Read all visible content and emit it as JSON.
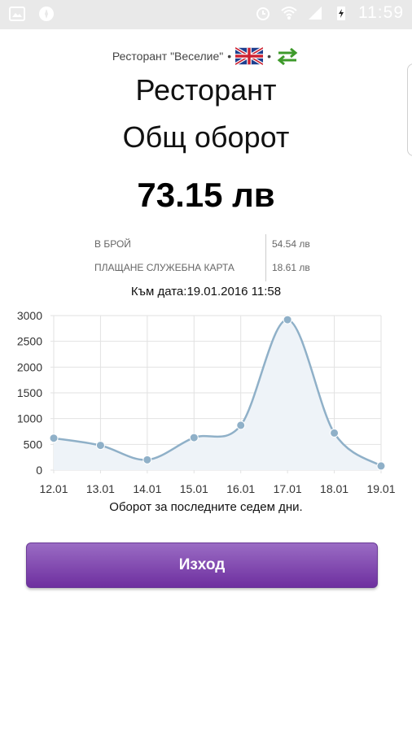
{
  "status_bar": {
    "time": "11:59",
    "icons": [
      "image-icon",
      "compass-icon",
      "alarm-icon",
      "wifi-icon",
      "signal-icon",
      "battery-charging-icon"
    ]
  },
  "header": {
    "restaurant_name": "Ресторант \"Веселие\"",
    "separator": "•",
    "language_flag": "uk-flag-icon",
    "switch_icon": "swap-arrows-icon"
  },
  "title_line1": "Ресторант",
  "title_line2": "Общ оборот",
  "total_amount": "73.15 лв",
  "breakdown": [
    {
      "label": "В БРОЙ",
      "value": "54.54 лв"
    },
    {
      "label": "ПЛАЩАНЕ СЛУЖЕБНА КАРТА",
      "value": "18.61 лв"
    }
  ],
  "as_of": "Към дата:19.01.2016 11:58",
  "chart_data": {
    "type": "area",
    "categories": [
      "12.01",
      "13.01",
      "14.01",
      "15.01",
      "16.01",
      "17.01",
      "18.01",
      "19.01"
    ],
    "values": [
      620,
      480,
      200,
      630,
      870,
      2920,
      720,
      80
    ],
    "ylim": [
      0,
      3000
    ],
    "yticks": [
      0,
      500,
      1000,
      1500,
      2000,
      2500,
      3000
    ],
    "grid": true,
    "colors": {
      "line": "#8fb0c8",
      "fill": "#eef3f8",
      "point": "#8fb0c8"
    }
  },
  "chart_caption": "Оборот за последните седем дни.",
  "exit_button_label": "Изход"
}
